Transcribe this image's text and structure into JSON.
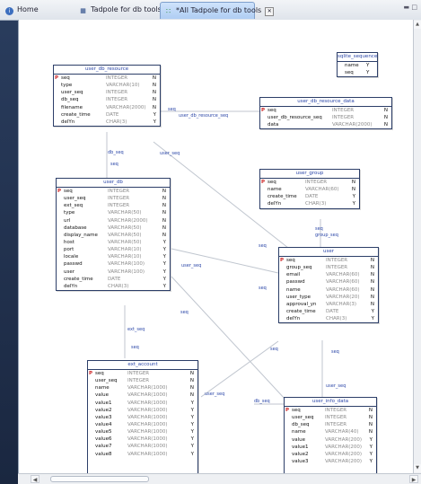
{
  "tabs": [
    {
      "label": "Home",
      "icon": "info-icon"
    },
    {
      "label": "Tadpole for db tools",
      "icon": "sql-icon"
    },
    {
      "label": "*All Tadpole for db tools",
      "icon": "erd-icon",
      "active": true
    }
  ],
  "tables": [
    {
      "id": "user_db_resource",
      "title": "user_db_resource",
      "colType": 58,
      "rows": [
        {
          "pk": true,
          "name": "seq",
          "type": "INTEGER",
          "flag": "N"
        },
        {
          "name": "type",
          "type": "VARCHAR(10)",
          "flag": "N"
        },
        {
          "name": "user_seq",
          "type": "INTEGER",
          "flag": "N"
        },
        {
          "name": "db_seq",
          "type": "INTEGER",
          "flag": "N"
        },
        {
          "name": "filename",
          "type": "VARCHAR(2000)",
          "flag": "N"
        },
        {
          "name": "create_time",
          "type": "DATE",
          "flag": "Y"
        },
        {
          "name": "delYn",
          "type": "CHAR(3)",
          "flag": "Y"
        }
      ]
    },
    {
      "id": "sqlite_sequence",
      "title": "sqlite_sequence",
      "colType": 0,
      "rows": [
        {
          "name": "name",
          "type": "",
          "flag": "Y"
        },
        {
          "name": "seq",
          "type": "",
          "flag": "Y"
        }
      ]
    },
    {
      "id": "user_db_resource_data",
      "title": "user_db_resource_data",
      "colType": 80,
      "rows": [
        {
          "pk": true,
          "name": "seq",
          "type": "INTEGER",
          "flag": "N"
        },
        {
          "name": "user_db_resource_seq",
          "type": "INTEGER",
          "flag": "N"
        },
        {
          "name": "data",
          "type": "VARCHAR(2000)",
          "flag": "N"
        }
      ]
    },
    {
      "id": "user_group",
      "title": "user_group",
      "colType": 50,
      "rows": [
        {
          "pk": true,
          "name": "seq",
          "type": "INTEGER",
          "flag": "N"
        },
        {
          "name": "name",
          "type": "VARCHAR(60)",
          "flag": "N"
        },
        {
          "name": "create_time",
          "type": "DATE",
          "flag": "Y"
        },
        {
          "name": "delYn",
          "type": "CHAR(3)",
          "flag": "Y"
        }
      ]
    },
    {
      "id": "user_db",
      "title": "user_db",
      "colType": 57,
      "rows": [
        {
          "pk": true,
          "name": "seq",
          "type": "INTEGER",
          "flag": "N"
        },
        {
          "name": "user_seq",
          "type": "INTEGER",
          "flag": "N"
        },
        {
          "name": "ext_seq",
          "type": "INTEGER",
          "flag": "N"
        },
        {
          "name": "type",
          "type": "VARCHAR(50)",
          "flag": "N"
        },
        {
          "name": "url",
          "type": "VARCHAR(2000)",
          "flag": "N"
        },
        {
          "name": "database",
          "type": "VARCHAR(50)",
          "flag": "N"
        },
        {
          "name": "display_name",
          "type": "VARCHAR(50)",
          "flag": "N"
        },
        {
          "name": "host",
          "type": "VARCHAR(50)",
          "flag": "Y"
        },
        {
          "name": "port",
          "type": "VARCHAR(10)",
          "flag": "Y"
        },
        {
          "name": "locale",
          "type": "VARCHAR(10)",
          "flag": "Y"
        },
        {
          "name": "passwd",
          "type": "VARCHAR(100)",
          "flag": "Y"
        },
        {
          "name": "user",
          "type": "VARCHAR(100)",
          "flag": "Y"
        },
        {
          "name": "create_time",
          "type": "DATE",
          "flag": "Y"
        },
        {
          "name": "delYn",
          "type": "CHAR(3)",
          "flag": "Y"
        }
      ]
    },
    {
      "id": "user",
      "title": "user",
      "colType": 52,
      "rows": [
        {
          "pk": true,
          "name": "seq",
          "type": "INTEGER",
          "flag": "N"
        },
        {
          "name": "group_seq",
          "type": "INTEGER",
          "flag": "N"
        },
        {
          "name": "email",
          "type": "VARCHAR(60)",
          "flag": "N"
        },
        {
          "name": "passwd",
          "type": "VARCHAR(60)",
          "flag": "N"
        },
        {
          "name": "name",
          "type": "VARCHAR(60)",
          "flag": "N"
        },
        {
          "name": "user_type",
          "type": "VARCHAR(20)",
          "flag": "N"
        },
        {
          "name": "approval_yn",
          "type": "VARCHAR(3)",
          "flag": "N"
        },
        {
          "name": "create_time",
          "type": "DATE",
          "flag": "Y"
        },
        {
          "name": "delYn",
          "type": "CHAR(3)",
          "flag": "Y"
        }
      ]
    },
    {
      "id": "ext_account",
      "title": "ext_account",
      "colType": 44,
      "rows": [
        {
          "pk": true,
          "name": "seq",
          "type": "INTEGER",
          "flag": "N"
        },
        {
          "name": "user_seq",
          "type": "INTEGER",
          "flag": "N"
        },
        {
          "name": "name",
          "type": "VARCHAR(1000)",
          "flag": "N"
        },
        {
          "name": "value",
          "type": "VARCHAR(1000)",
          "flag": "N"
        },
        {
          "name": "value1",
          "type": "VARCHAR(1000)",
          "flag": "Y"
        },
        {
          "name": "value2",
          "type": "VARCHAR(1000)",
          "flag": "Y"
        },
        {
          "name": "value3",
          "type": "VARCHAR(1000)",
          "flag": "Y"
        },
        {
          "name": "value4",
          "type": "VARCHAR(1000)",
          "flag": "Y"
        },
        {
          "name": "value5",
          "type": "VARCHAR(1000)",
          "flag": "Y"
        },
        {
          "name": "value6",
          "type": "VARCHAR(1000)",
          "flag": "Y"
        },
        {
          "name": "value7",
          "type": "VARCHAR(1000)",
          "flag": "Y"
        },
        {
          "name": "value8",
          "type": "VARCHAR(1000)",
          "flag": "Y"
        }
      ]
    },
    {
      "id": "user_info_data",
      "title": "user_info_data",
      "colType": 45,
      "rows": [
        {
          "pk": true,
          "name": "seq",
          "type": "INTEGER",
          "flag": "N"
        },
        {
          "name": "user_seq",
          "type": "INTEGER",
          "flag": "N"
        },
        {
          "name": "db_seq",
          "type": "INTEGER",
          "flag": "N"
        },
        {
          "name": "name",
          "type": "VARCHAR(40)",
          "flag": "N"
        },
        {
          "name": "value",
          "type": "VARCHAR(200)",
          "flag": "Y"
        },
        {
          "name": "value1",
          "type": "VARCHAR(200)",
          "flag": "Y"
        },
        {
          "name": "value2",
          "type": "VARCHAR(200)",
          "flag": "Y"
        },
        {
          "name": "value3",
          "type": "VARCHAR(200)",
          "flag": "Y"
        }
      ]
    }
  ],
  "relations": [
    "seq",
    "user_db_resource_seq",
    "db_seq",
    "seq",
    "user_seq",
    "seq",
    "group_seq",
    "seq",
    "user_seq",
    "seq",
    "seq",
    "ext_seq",
    "seq",
    "seq",
    "user_seq",
    "db_seq",
    "user_seq",
    "seq"
  ],
  "colors": {
    "header_text": "#2c47a8",
    "border": "#2c3e68",
    "pk": "#cc2222",
    "type_text": "#8a8a8a",
    "line": "#c0c6cf"
  }
}
